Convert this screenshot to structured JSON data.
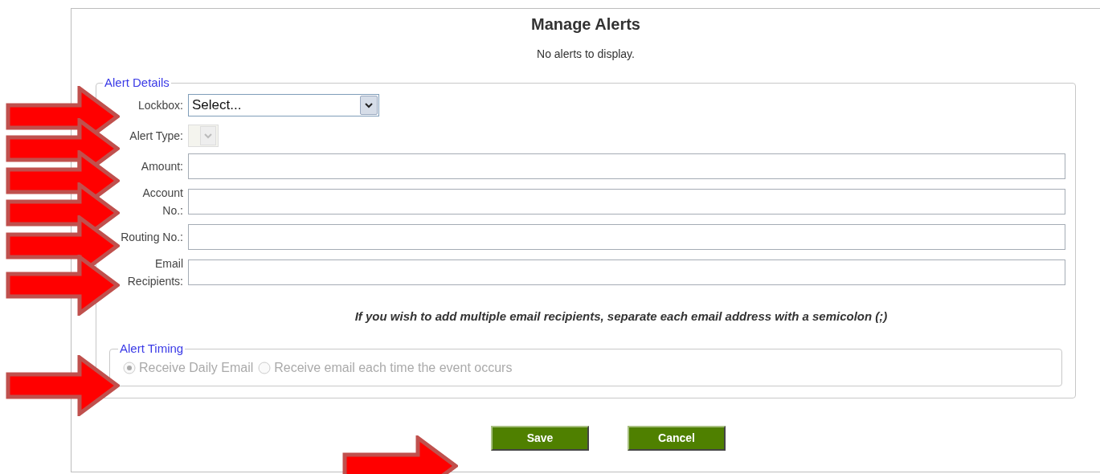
{
  "title": "Manage Alerts",
  "message": "No alerts to display.",
  "alert_details": {
    "legend": "Alert Details",
    "fields": [
      {
        "kind": "select",
        "label": "Lockbox:",
        "value": "Select...",
        "disabled": false
      },
      {
        "kind": "select",
        "label": "Alert Type:",
        "disabled": true
      },
      {
        "kind": "text",
        "label": "Amount:"
      },
      {
        "kind": "text",
        "label": "Account No.:"
      },
      {
        "kind": "text",
        "label": "Routing No.:"
      },
      {
        "kind": "text",
        "label": "Email Recipients:"
      }
    ],
    "note": "If you wish to add multiple email recipients, separate each email address with a semicolon (;)"
  },
  "alert_timing": {
    "legend": "Alert Timing",
    "options": [
      {
        "label": "Receive Daily Email",
        "selected": true,
        "disabled": true
      },
      {
        "label": "Receive email each time the event occurs",
        "selected": false,
        "disabled": true
      }
    ]
  },
  "buttons": [
    "Save",
    "Cancel"
  ]
}
